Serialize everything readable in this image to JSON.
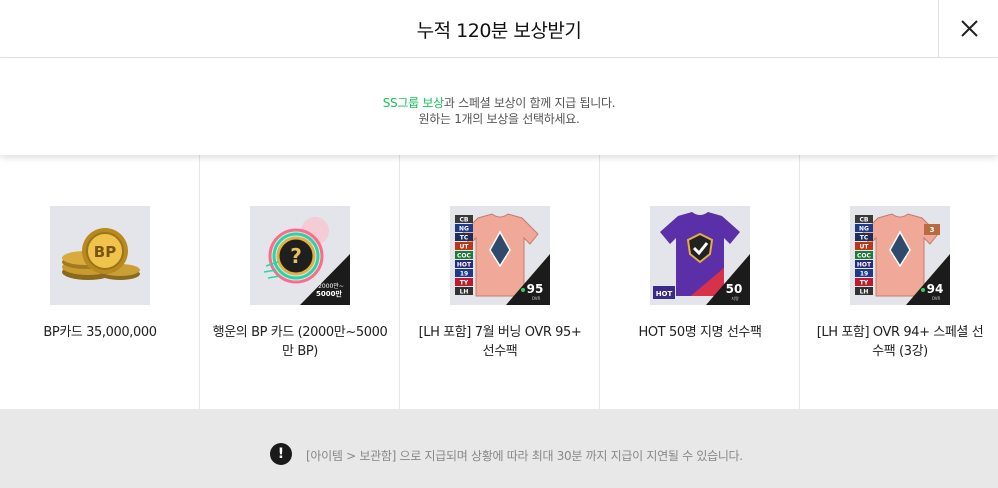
{
  "header": {
    "title": "누적 120분 보상받기",
    "close_label": "×"
  },
  "notice": {
    "highlight": "SS그룹 보상",
    "line1_rest": "과 스페셜 보상이 함께 지급 됩니다.",
    "line2": "원하는 1개의 보상을 선택하세요.",
    "highlight_color": "#18c15a"
  },
  "rewards": [
    {
      "label": "BP카드 35,000,000",
      "icon": "bp-coins-icon"
    },
    {
      "label": "행운의 BP 카드 (2000만~5000만 BP)",
      "icon": "lucky-bp-card-icon",
      "badge": "2000만~\n5000만"
    },
    {
      "label": "[LH 포함] 7월 버닝 OVR 95+ 선수팩",
      "icon": "player-pack-jersey-icon",
      "badge": "95",
      "badge_sub": "OVR",
      "tags": [
        "CB",
        "NG",
        "TC",
        "UT",
        "COC",
        "HOT",
        "19",
        "TY",
        "LH"
      ]
    },
    {
      "label": "HOT 50명 지명 선수팩",
      "icon": "hot-jersey-icon",
      "badge": "50",
      "badge_sub": "지명",
      "tag": "HOT"
    },
    {
      "label": "[LH 포함] OVR 94+ 스페셜 선수팩 (3강)",
      "icon": "special-pack-jersey-icon",
      "badge": "94",
      "badge_sub": "OVR",
      "upgrade": "3",
      "tags": [
        "CB",
        "NG",
        "TC",
        "UT",
        "COC",
        "HOT",
        "19",
        "TY",
        "LH"
      ]
    }
  ],
  "footer": {
    "info_icon": "!",
    "text": "[아이템 > 보관함] 으로 지급되며 상황에 따라 최대 30분 까지 지급이 지연될 수 있습니다."
  }
}
